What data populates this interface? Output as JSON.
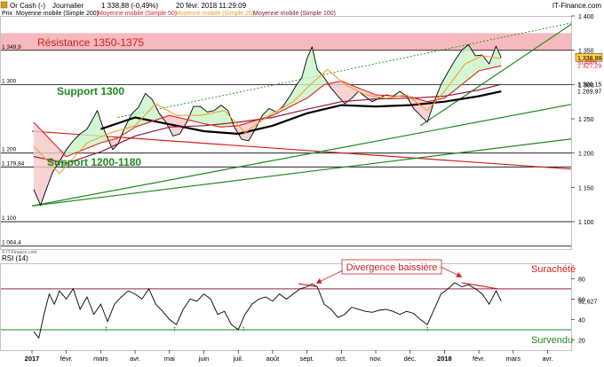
{
  "header": {
    "instrument": "Or Cash (-)",
    "period": "Journalier",
    "quote": "1 338,88 (-0,49%)",
    "datetime": "20 févr. 2018 11:29:09",
    "source": "IT-Finance.com",
    "legend_price": "Prix",
    "legend_sma200": "Moyenne mobile (Simple 200)",
    "legend_sma50": "Moyenne mobile (Simple 50)",
    "legend_sma20": "Moyenne mobile (Simple 20)",
    "legend_sma100": "Moyenne mobile (Simple 100)",
    "copyright": "© IT-Finance.com"
  },
  "colors": {
    "price": "#000000",
    "sma200": "#000000",
    "sma100": "#8b1a3a",
    "sma50": "#e02020",
    "sma20": "#f0a030",
    "resistance_band": "#f6b9bd",
    "green_line": "#1e8a1e",
    "red_line": "#d02020",
    "support_text": "#1e8a1e",
    "resistance_text": "#d02020",
    "rsi_line": "#000000",
    "overbought_line": "#9b1b4b",
    "oversold_line": "#1e8a1e"
  },
  "annotations": {
    "resistance": "Résistance 1350-1375",
    "support_1300": "Support 1300",
    "support_1200": "Support 1200-1180",
    "divergence": "Divergence baissière",
    "overbought": "Surachété",
    "oversold": "Survendu"
  },
  "chart_data": [
    {
      "type": "line",
      "panel": "price",
      "ylim": [
        1060,
        1400
      ],
      "y_ticks": [
        "1 400",
        "1 350",
        "1 300",
        "1 250",
        "1 200",
        "1 150",
        "1 100"
      ],
      "level_labels": [
        "1 349,9",
        "1 300",
        "1 200",
        "1 179,84",
        "1 100",
        "1 064,4"
      ],
      "level_values": [
        1349.9,
        1300,
        1200,
        1179.84,
        1100,
        1064.4
      ],
      "right_labels": [
        {
          "text": "1 338,88",
          "value": 1338.88
        },
        {
          "text": "-0,49%",
          "value": 1333
        },
        {
          "text": "1 327,29",
          "value": 1327.29
        },
        {
          "text": "1 300,15",
          "value": 1300.15
        },
        {
          "text": "1 289,97",
          "value": 1289.97
        }
      ],
      "resistance_zone": [
        1350,
        1375
      ],
      "x_labels": [
        "2017",
        "févr.",
        "mars",
        "avr.",
        "mai",
        "juin",
        "juil.",
        "août",
        "sept.",
        "oct.",
        "nov.",
        "déc.",
        "2018",
        "févr.",
        "mars",
        "avr."
      ],
      "x_months": [
        0,
        1,
        2,
        3,
        4,
        5,
        6,
        7,
        8,
        9,
        10,
        11,
        12,
        13,
        14,
        15
      ],
      "series": [
        {
          "name": "Prix",
          "x": [
            0.05,
            0.25,
            0.4,
            0.6,
            0.8,
            1.0,
            1.2,
            1.4,
            1.6,
            1.75,
            1.9,
            2.05,
            2.2,
            2.35,
            2.5,
            2.7,
            2.9,
            3.1,
            3.3,
            3.5,
            3.7,
            3.9,
            4.1,
            4.3,
            4.5,
            4.7,
            4.9,
            5.1,
            5.3,
            5.5,
            5.7,
            5.9,
            6.1,
            6.3,
            6.5,
            6.7,
            6.9,
            7.1,
            7.3,
            7.5,
            7.7,
            7.85,
            8.0,
            8.15,
            8.3,
            8.5,
            8.7,
            8.9,
            9.1,
            9.3,
            9.5,
            9.7,
            9.9,
            10.1,
            10.3,
            10.5,
            10.7,
            10.9,
            11.1,
            11.3,
            11.5,
            11.7,
            11.9,
            12.1,
            12.3,
            12.5,
            12.7,
            12.9,
            13.1,
            13.3,
            13.5,
            13.65
          ],
          "values": [
            1147,
            1124,
            1145,
            1172,
            1188,
            1205,
            1218,
            1228,
            1235,
            1248,
            1262,
            1240,
            1222,
            1205,
            1213,
            1237,
            1257,
            1267,
            1287,
            1278,
            1258,
            1245,
            1225,
            1228,
            1245,
            1268,
            1268,
            1260,
            1262,
            1270,
            1262,
            1237,
            1220,
            1218,
            1235,
            1255,
            1265,
            1260,
            1268,
            1283,
            1300,
            1310,
            1338,
            1355,
            1322,
            1310,
            1295,
            1283,
            1272,
            1280,
            1290,
            1282,
            1275,
            1280,
            1285,
            1283,
            1290,
            1283,
            1265,
            1255,
            1245,
            1275,
            1300,
            1318,
            1335,
            1350,
            1358,
            1342,
            1343,
            1330,
            1356,
            1339
          ]
        },
        {
          "name": "Moyenne mobile (Simple 200)",
          "x": [
            2.0,
            3.0,
            4.0,
            5.0,
            6.0,
            7.0,
            8.0,
            9.0,
            10.0,
            11.0,
            12.0,
            13.0,
            13.65
          ],
          "values": [
            1235,
            1252,
            1242,
            1232,
            1228,
            1240,
            1258,
            1270,
            1268,
            1270,
            1275,
            1283,
            1289.97
          ]
        },
        {
          "name": "Moyenne mobile (Simple 100)",
          "x": [
            0.05,
            1.0,
            2.0,
            3.0,
            4.0,
            5.0,
            6.0,
            7.0,
            8.0,
            9.0,
            10.0,
            11.0,
            12.0,
            13.0,
            13.65
          ],
          "values": [
            1195,
            1185,
            1202,
            1225,
            1238,
            1240,
            1245,
            1252,
            1264,
            1275,
            1279,
            1280,
            1283,
            1292,
            1300.15
          ]
        },
        {
          "name": "Moyenne mobile (Simple 50)",
          "x": [
            0.05,
            1.0,
            2.0,
            2.5,
            3.0,
            4.0,
            5.0,
            5.5,
            6.0,
            7.0,
            8.0,
            8.5,
            9.0,
            10.0,
            11.0,
            11.5,
            12.0,
            12.5,
            13.0,
            13.65
          ],
          "values": [
            1245,
            1195,
            1215,
            1222,
            1238,
            1255,
            1243,
            1238,
            1240,
            1255,
            1280,
            1300,
            1305,
            1285,
            1282,
            1275,
            1280,
            1300,
            1320,
            1327.29
          ]
        },
        {
          "name": "Moyenne mobile (Simple 20)",
          "x": [
            0.05,
            0.8,
            1.6,
            2.3,
            3.0,
            3.6,
            4.2,
            4.9,
            5.6,
            6.2,
            6.9,
            7.6,
            8.1,
            8.6,
            9.1,
            9.7,
            10.3,
            10.9,
            11.5,
            12.0,
            12.6,
            13.1,
            13.65
          ],
          "values": [
            1210,
            1170,
            1215,
            1230,
            1240,
            1272,
            1255,
            1255,
            1262,
            1230,
            1255,
            1275,
            1300,
            1322,
            1300,
            1285,
            1280,
            1285,
            1262,
            1290,
            1330,
            1342,
            1338
          ]
        }
      ],
      "trendlines": [
        {
          "name": "resistance-diagonal",
          "x": [
            0,
            15.9
          ],
          "values": [
            1232,
            1176
          ]
        },
        {
          "name": "rising-channel-dotted",
          "x": [
            2.5,
            15.9
          ],
          "values": [
            1252,
            1392
          ]
        },
        {
          "name": "rising-support-1",
          "x": [
            0,
            15.9
          ],
          "values": [
            1123,
            1273
          ]
        },
        {
          "name": "rising-support-2",
          "x": [
            0,
            15.9
          ],
          "values": [
            1123,
            1222
          ]
        },
        {
          "name": "steep-support",
          "x": [
            11.3,
            15.9
          ],
          "values": [
            1240,
            1395
          ]
        }
      ]
    },
    {
      "type": "line",
      "panel": "rsi",
      "title": "RSI (14)",
      "ylim": [
        10,
        95
      ],
      "y_ticks": [
        "80",
        "60",
        "40",
        "20"
      ],
      "overbought": 70,
      "oversold": 30,
      "last_value_label": "52,627",
      "x": [
        0.05,
        0.2,
        0.35,
        0.5,
        0.65,
        0.8,
        1.0,
        1.2,
        1.4,
        1.6,
        1.8,
        2.0,
        2.2,
        2.4,
        2.6,
        2.8,
        3.0,
        3.2,
        3.4,
        3.6,
        3.8,
        4.0,
        4.2,
        4.4,
        4.6,
        4.8,
        5.0,
        5.2,
        5.4,
        5.6,
        5.8,
        6.0,
        6.2,
        6.4,
        6.6,
        6.8,
        7.0,
        7.2,
        7.4,
        7.6,
        7.8,
        8.0,
        8.15,
        8.3,
        8.5,
        8.7,
        8.9,
        9.1,
        9.3,
        9.5,
        9.7,
        9.9,
        10.1,
        10.3,
        10.5,
        10.7,
        10.9,
        11.1,
        11.3,
        11.5,
        11.7,
        11.9,
        12.1,
        12.3,
        12.5,
        12.7,
        12.9,
        13.1,
        13.3,
        13.5,
        13.65
      ],
      "values": [
        28,
        22,
        45,
        65,
        55,
        68,
        60,
        70,
        50,
        62,
        45,
        55,
        38,
        55,
        62,
        68,
        65,
        60,
        70,
        55,
        48,
        40,
        35,
        50,
        60,
        58,
        65,
        60,
        45,
        48,
        35,
        30,
        45,
        55,
        60,
        62,
        58,
        65,
        60,
        65,
        70,
        72,
        75,
        72,
        55,
        50,
        42,
        45,
        52,
        50,
        48,
        47,
        49,
        50,
        48,
        45,
        48,
        46,
        40,
        35,
        50,
        65,
        70,
        76,
        72,
        74,
        70,
        65,
        55,
        68,
        58
      ],
      "signals": [
        {
          "text": "↑",
          "x": 2.15
        },
        {
          "text": "↑",
          "x": 4.15
        },
        {
          "text": "↑",
          "x": 6.15
        },
        {
          "text": "↑",
          "x": 11.5
        }
      ],
      "divergence_lines": [
        {
          "name": "divergence-left",
          "x": [
            7.75,
            8.3
          ],
          "values": [
            75,
            72
          ]
        },
        {
          "name": "divergence-right",
          "x": [
            12.5,
            13.55
          ],
          "values": [
            76,
            70
          ]
        }
      ]
    }
  ]
}
